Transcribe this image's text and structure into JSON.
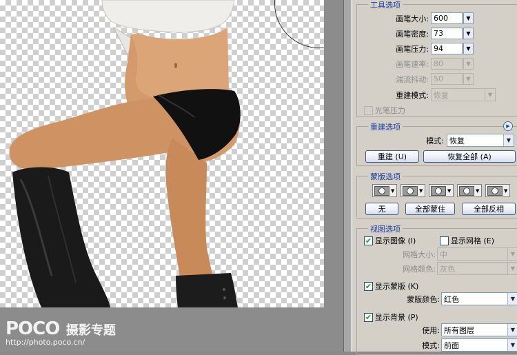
{
  "watermark": {
    "logo": "POCO",
    "title": "摄影专题",
    "url": "http://photo.poco.cn/"
  },
  "tool_options": {
    "title": "工具选项",
    "brush_size": {
      "label": "画笔大小:",
      "value": "600"
    },
    "brush_density": {
      "label": "画笔密度:",
      "value": "73"
    },
    "brush_pressure": {
      "label": "画笔压力:",
      "value": "94"
    },
    "brush_rate": {
      "label": "画笔速率:",
      "value": "80"
    },
    "turbulent_jitter": {
      "label": "湍流抖动:",
      "value": "50"
    },
    "reconstruct_mode": {
      "label": "重建模式:",
      "value": "恢复"
    },
    "stylus_pressure": {
      "label": "光笔压力"
    }
  },
  "reconstruct_options": {
    "title": "重建选项",
    "mode_label": "模式:",
    "mode_value": "恢复",
    "reconstruct_button": "重建 (U)",
    "restore_all_button": "恢复全部 (A)"
  },
  "mask_options": {
    "title": "蒙版选项",
    "none_button": "无",
    "mask_all_button": "全部蒙住",
    "invert_all_button": "全部反相"
  },
  "view_options": {
    "title": "视图选项",
    "show_image": "显示图像 (I)",
    "show_mesh": "显示网格 (E)",
    "mesh_size_label": "网格大小:",
    "mesh_size_value": "中",
    "mesh_color_label": "网格颜色:",
    "mesh_color_value": "灰色",
    "show_mask": "显示蒙版 (K)",
    "mask_color_label": "蒙版颜色:",
    "mask_color_value": "红色",
    "show_backdrop": "显示背景 (P)",
    "use_label": "使用:",
    "use_value": "所有图层",
    "mode_label": "模式:",
    "mode_value": "前面"
  },
  "colors": {
    "accent": "#1a3fa0",
    "panel": "#d4d0c8",
    "check": "#21a121"
  }
}
